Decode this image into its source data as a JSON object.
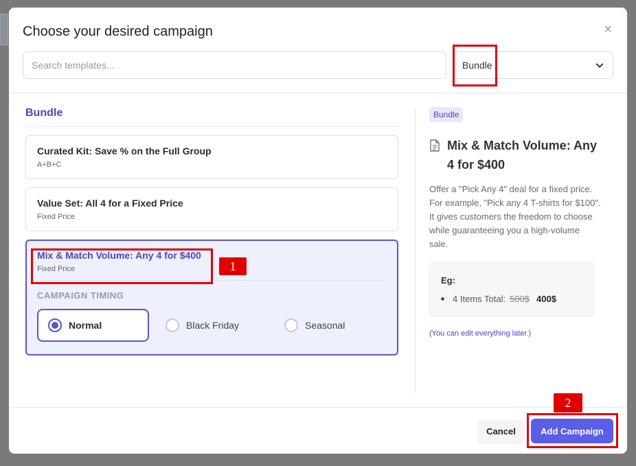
{
  "modal": {
    "title": "Choose your desired campaign",
    "close_glyph": "×"
  },
  "search": {
    "placeholder": "Search templates...",
    "value": ""
  },
  "category_select": {
    "value": "Bundle",
    "icon": "chevron-down-icon"
  },
  "section": {
    "title": "Bundle"
  },
  "templates": [
    {
      "title": "Curated Kit: Save % on the Full Group",
      "subtitle": "A+B+C"
    },
    {
      "title": "Value Set: All 4 for a Fixed Price",
      "subtitle": "Fixed Price"
    },
    {
      "title": "Mix & Match Volume: Any 4 for $400",
      "subtitle": "Fixed Price",
      "selected": true
    }
  ],
  "timing": {
    "label": "CAMPAIGN TIMING",
    "options": [
      "Normal",
      "Black Friday",
      "Seasonal"
    ],
    "selected": "Normal"
  },
  "preview": {
    "badge": "Bundle",
    "title": "Mix & Match Volume: Any 4 for $400",
    "description": "Offer a \"Pick Any 4\" deal for a fixed price. For example, \"Pick any 4 T-shirts for $100\". It gives customers the freedom to choose while guaranteeing you a high-volume sale.",
    "example_label": "Eg:",
    "example_prefix": "4 Items Total:",
    "example_old_price": "500$",
    "example_new_price": "400$",
    "edit_note": "(You can edit everything later.)"
  },
  "footer": {
    "cancel_label": "Cancel",
    "add_label": "Add Campaign"
  },
  "annotations": {
    "tag1": "1",
    "tag2": "2"
  },
  "colors": {
    "accent": "#5b5ee6",
    "accent_text": "#4a44c6",
    "annotation_red": "#e00000"
  }
}
